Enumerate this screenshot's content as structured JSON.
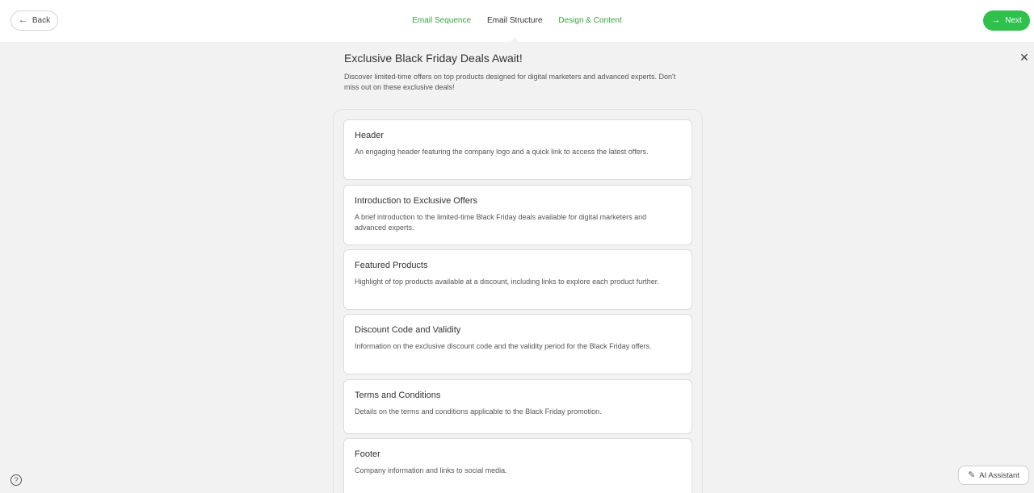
{
  "header": {
    "back_label": "Back",
    "next_label": "Next",
    "tabs": [
      {
        "label": "Email Sequence",
        "active": false
      },
      {
        "label": "Email Structure",
        "active": true
      },
      {
        "label": "Design & Content",
        "active": false
      }
    ]
  },
  "email": {
    "title": "Exclusive Black Friday Deals Await!",
    "description": "Discover limited-time offers on top products designed for digital marketers and advanced experts. Don't miss out on these exclusive deals!"
  },
  "sections": [
    {
      "title": "Header",
      "description": "An engaging header featuring the company logo and a quick link to access the latest offers."
    },
    {
      "title": "Introduction to Exclusive Offers",
      "description": "A brief introduction to the limited-time Black Friday deals available for digital marketers and advanced experts."
    },
    {
      "title": "Featured Products",
      "description": "Highlight of top products available at a discount, including links to explore each product further."
    },
    {
      "title": "Discount Code and Validity",
      "description": "Information on the exclusive discount code and the validity period for the Black Friday offers."
    },
    {
      "title": "Terms and Conditions",
      "description": "Details on the terms and conditions applicable to the Black Friday promotion."
    },
    {
      "title": "Footer",
      "description": "Company information and links to social media."
    }
  ],
  "ai_assistant_label": "AI Assistant",
  "colors": {
    "accent": "#2fc14b",
    "tab_link": "#3aa53f",
    "background": "#f2f2f2"
  },
  "icons": {
    "back": "arrow-left-icon",
    "next": "arrow-right-icon",
    "close": "close-icon",
    "help": "help-circle-icon",
    "ai": "magic-wand-icon"
  }
}
